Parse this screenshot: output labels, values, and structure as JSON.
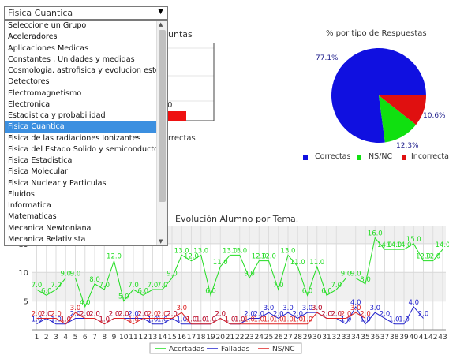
{
  "group_select": {
    "selected": "Fisica Cuantica",
    "options": [
      "Seleccione un Grupo",
      "Aceleradores",
      "Aplicaciones Medicas",
      "Constantes , Unidades y medidas",
      "Cosmologia, astrofisica y evolucion estelar",
      "Detectores",
      "Electromagnetismo",
      "Electronica",
      "Estadistica y probabilidad",
      "Fisica Cuantica",
      "Fisica de las radiaciones Ionizantes",
      "Fisica del Estado Solido y semiconductores",
      "Fisica Estadistica",
      "Fisica Molecular",
      "Fisica Nuclear y Particulas",
      "Fluidos",
      "Informatica",
      "Matematicas",
      "Mecanica Newtoniana",
      "Mecanica Relativista"
    ],
    "selected_index": 9
  },
  "bar_panel": {
    "title_fragment": "untas",
    "value_fragment": ".0",
    "legend_fragment": "rrectas"
  },
  "pie_chart": {
    "title": "% por tipo de Respuestas",
    "colors": {
      "Correctas": "#1010e0",
      "NS/NC": "#10e010",
      "Incorrectas": "#e01010"
    },
    "chart_data": {
      "type": "pie",
      "title": "% por tipo de Respuestas",
      "slices": [
        {
          "name": "Correctas",
          "value": 77.1,
          "label": "77.1%"
        },
        {
          "name": "NS/NC",
          "value": 12.3,
          "label": "12.3%"
        },
        {
          "name": "Incorrectas",
          "value": 10.6,
          "label": "10.6%"
        }
      ],
      "legend": [
        "Correctas",
        "NS/NC",
        "Incorrectas"
      ],
      "legend_position": "bottom"
    }
  },
  "line_chart": {
    "title": "Evolución Alumno por Tema.",
    "colors": {
      "Acertadas": "#22dd22",
      "Falladas": "#2222cc",
      "NS/NC": "#dd2222"
    },
    "chart_data": {
      "type": "line",
      "title": "Evolución Alumno por Tema.",
      "x": [
        1,
        2,
        3,
        4,
        5,
        6,
        7,
        8,
        9,
        10,
        11,
        12,
        13,
        14,
        15,
        16,
        17,
        18,
        19,
        20,
        21,
        22,
        23,
        24,
        25,
        26,
        27,
        28,
        29,
        30,
        31,
        32,
        33,
        34,
        35,
        36,
        37,
        38,
        39,
        40,
        41,
        42,
        43
      ],
      "ylim": [
        0,
        18
      ],
      "yticks": [
        5,
        10,
        15
      ],
      "grid": true,
      "legend_position": "bottom",
      "series": [
        {
          "name": "Acertadas",
          "values": [
            7,
            6,
            7,
            9,
            9,
            4,
            8,
            7,
            12,
            5,
            7,
            6,
            7,
            7,
            9,
            13,
            12,
            13,
            6,
            11,
            13,
            13,
            9,
            12,
            12,
            7,
            13,
            11,
            6,
            11,
            6,
            7,
            9,
            9,
            8,
            16,
            14,
            14,
            14,
            15,
            12,
            12,
            14
          ]
        },
        {
          "name": "Falladas",
          "values": [
            1,
            2,
            1,
            1,
            2,
            2,
            2,
            1,
            2,
            2,
            2,
            2,
            1,
            1,
            2,
            1,
            1,
            1,
            1,
            2,
            1,
            1,
            2,
            2,
            3,
            2,
            3,
            2,
            3,
            3,
            2,
            2,
            1,
            4,
            1,
            3,
            2,
            1,
            1,
            4,
            2,
            null,
            null
          ]
        },
        {
          "name": "NS/NC",
          "values": [
            2,
            2,
            2,
            1,
            3,
            2,
            2,
            1,
            2,
            2,
            1,
            2,
            2,
            2,
            2,
            3,
            1,
            1,
            1,
            2,
            1,
            1,
            1,
            1,
            1,
            1,
            1,
            1,
            1,
            3,
            2,
            2,
            2,
            3,
            2,
            null,
            null,
            null,
            null,
            null,
            null,
            null,
            null
          ]
        }
      ]
    }
  }
}
